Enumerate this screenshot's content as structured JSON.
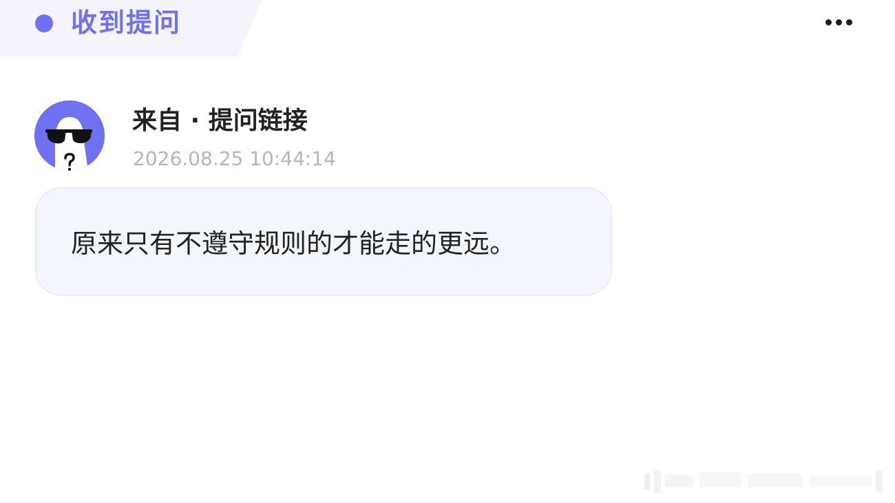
{
  "header": {
    "title": "收到提问"
  },
  "more_menu": {
    "icon": "more-horizontal-icon"
  },
  "message": {
    "avatar_icon": "anonymous-sunglasses-avatar",
    "sender_label": "来自 · 提问链接",
    "timestamp": "2026.08.25 10:44:14",
    "body": "原来只有不遵守规则的才能走的更远。"
  },
  "colors": {
    "accent": "#6f71f0",
    "header_bg": "#f4f5fc",
    "bubble_bg": "#f3f7fd",
    "text_primary": "#222222",
    "text_muted": "#b4b6bd"
  }
}
